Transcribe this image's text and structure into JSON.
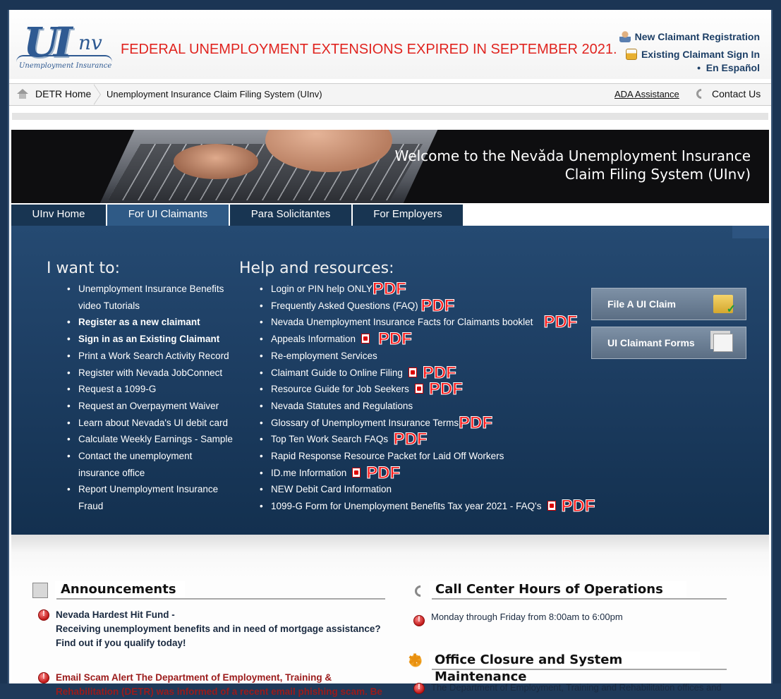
{
  "header": {
    "logo_text": "UInv",
    "logo_tagline": "Unemployment Insurance",
    "alert_banner": "FEDERAL UNEMPLOYMENT EXTENSIONS EXPIRED IN SEPTEMBER 2021.",
    "new_claimant": "New Claimant Registration",
    "existing_claimant": "Existing Claimant Sign In",
    "espanol": "En Español"
  },
  "breadcrumb": {
    "home": "DETR Home",
    "current": "Unemployment Insurance Claim Filing System (UInv)",
    "ada": "ADA Assistance",
    "contact": "Contact Us"
  },
  "hero": {
    "line1": "Welcome to the Nevǎda Unemployment Insurance",
    "line2": "Claim Filing System (UInv)"
  },
  "tabs": [
    {
      "label": "UInv Home",
      "active": false
    },
    {
      "label": "For UI Claimants",
      "active": true
    },
    {
      "label": "Para Solicitantes",
      "active": false
    },
    {
      "label": "For Employers",
      "active": false
    }
  ],
  "i_want_to": {
    "title": "I want to:",
    "items": [
      "Unemployment Insurance Benefits video Tutorials",
      "Register as a new claimant",
      "Sign in as an Existing Claimant",
      "Print a Work Search Activity Record",
      "Register with Nevada JobConnect",
      "Request a 1099-G",
      "Request an Overpayment Waiver",
      "Learn about Nevada's UI debit card",
      "Calculate Weekly Earnings - Sample",
      "Contact the unemployment insurance office",
      "Report Unemployment Insurance Fraud"
    ]
  },
  "help": {
    "title": "Help and resources:",
    "pdf_label": "PDF",
    "items": [
      "Login or PIN help ONLY",
      "Frequently Asked Questions (FAQ)",
      "Nevada Unemployment Insurance Facts for Claimants booklet",
      "Appeals Information",
      "Re-employment Services",
      "Claimant Guide to Online Filing",
      "Resource Guide for Job Seekers",
      "Nevada Statutes and Regulations",
      "Glossary of Unemployment Insurance Terms",
      "Top Ten Work Search FAQs",
      "Rapid Response Resource Packet for Laid Off Workers",
      "ID.me Information",
      "NEW Debit Card Information",
      "1099-G Form for Unemployment Benefits Tax year 2021 - FAQ's"
    ]
  },
  "buttons": {
    "file_claim": "File A UI Claim",
    "claimant_forms": "UI Claimant Forms"
  },
  "announcements": {
    "title": "Announcements",
    "item1_title": "Nevada Hardest Hit Fund -",
    "item1_body1": "Receiving unemployment benefits and in need of mortgage assistance?",
    "item1_body2": "Find out if you qualify today!",
    "item2_line1": "Email Scam Alert The Department of Employment, Training &",
    "item2_line2": "Rehabilitation (DETR) was informed of a recent email phishing scam. Be"
  },
  "call_center": {
    "title": "Call Center Hours of Operations",
    "hours": "Monday through Friday from 8:00am to 6:00pm"
  },
  "closure": {
    "title": "Office Closure and System Maintenance",
    "text": "The Department of Employment, Training and Rehabilitation offices and"
  },
  "colors": {
    "alert_red": "#e0241f",
    "panel_blue": "#1e3f64",
    "tab_dark": "#183552",
    "tab_active": "#2f5a86"
  }
}
